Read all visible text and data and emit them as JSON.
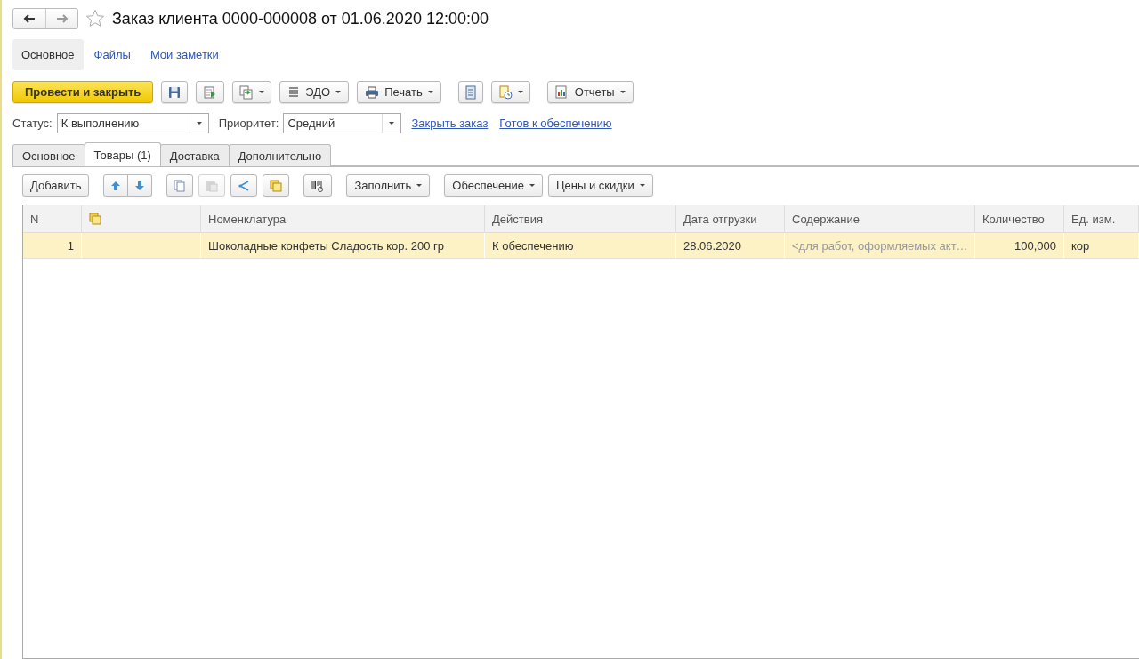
{
  "window": {
    "title": "Заказ клиента 0000-000008 от 01.06.2020 12:00:00",
    "favorite": false
  },
  "nav": [
    {
      "label": "Основное",
      "selected": true
    },
    {
      "label": "Файлы",
      "selected": false
    },
    {
      "label": "Мои заметки",
      "selected": false
    }
  ],
  "toolbar": {
    "post_button": "Провести и закрыть",
    "edo_button": "ЭДО",
    "print_button": "Печать",
    "reports_button": "Отчеты"
  },
  "status": {
    "label": "Статус:",
    "value": "К выполнению"
  },
  "priority": {
    "label": "Приоритет:",
    "value": "Средний"
  },
  "links": [
    "Закрыть заказ",
    "Готов к обеспечению"
  ],
  "tabs": [
    {
      "label": "Основное",
      "selected": false
    },
    {
      "label": "Товары (1)",
      "selected": true
    },
    {
      "label": "Доставка",
      "selected": false
    },
    {
      "label": "Дополнительно",
      "selected": false
    }
  ],
  "table_toolbar": {
    "add_button": "Добавить",
    "fill_button": "Заполнить",
    "supply_button": "Обеспечение",
    "prices_button": "Цены и скидки"
  },
  "table": {
    "columns": [
      "N",
      "Номенклатура",
      "Действия",
      "Дата отгрузки",
      "Содержание",
      "Количество",
      "Ед. изм."
    ],
    "rows": [
      {
        "n": "1",
        "item": "Шоколадные конфеты Сладость кор. 200 гр",
        "action": "К обеспечению",
        "date": "28.06.2020",
        "content_placeholder": "<для работ, оформляемых акт…",
        "quantity": "100,000",
        "unit": "кор",
        "selected": true
      }
    ]
  }
}
